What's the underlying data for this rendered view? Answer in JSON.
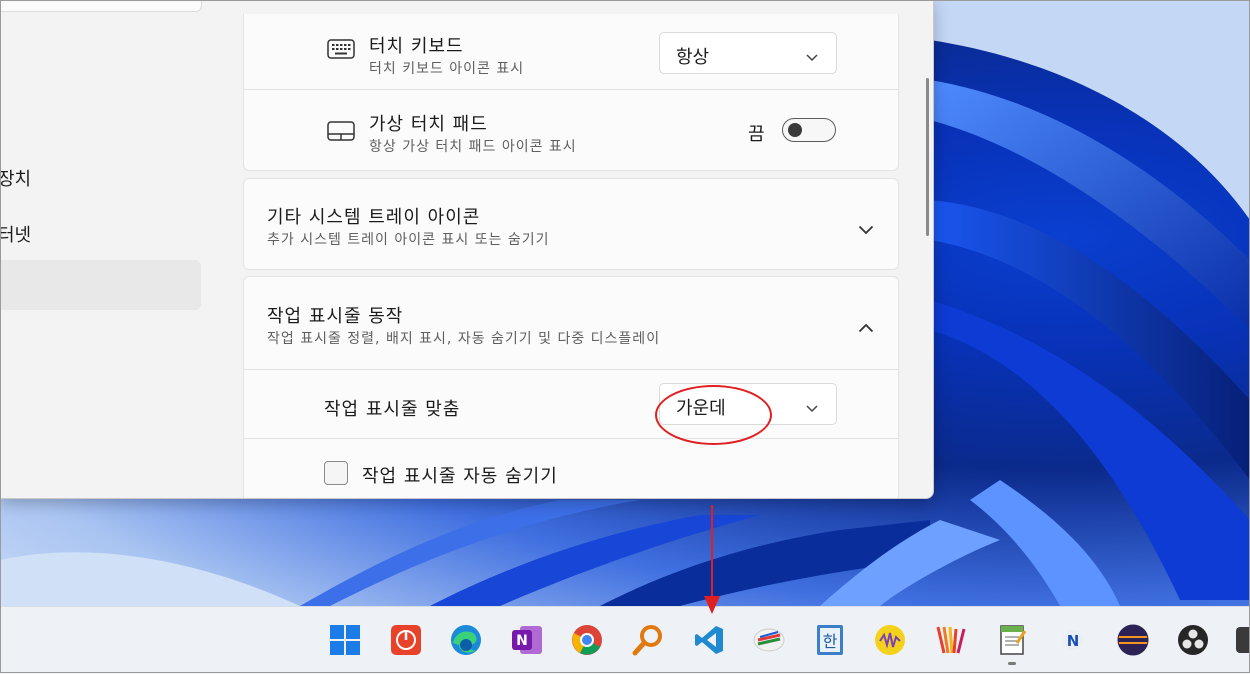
{
  "nav": {
    "item_devices": "장치",
    "item_network": "터넷"
  },
  "rows": {
    "touch_keyboard": {
      "title": "터치 키보드",
      "subtitle": "터치 키보드 아이콘 표시",
      "dropdown_value": "항상",
      "icon": "keyboard-icon"
    },
    "virtual_touchpad": {
      "title": "가상 터치 패드",
      "subtitle": "항상 가상 터치 패드 아이콘 표시",
      "toggle_label": "끔",
      "toggle_state": "off",
      "icon": "touchpad-icon"
    }
  },
  "sections": {
    "other_tray": {
      "title": "기타 시스템 트레이 아이콘",
      "subtitle": "추가 시스템 트레이 아이콘 표시 또는 숨기기",
      "expanded": false
    },
    "taskbar_behavior": {
      "title": "작업 표시줄 동작",
      "subtitle": "작업 표시줄 정렬, 배지 표시, 자동 숨기기 및 다중 디스플레이",
      "expanded": true,
      "alignment_label": "작업 표시줄 맞춤",
      "alignment_value": "가운데",
      "autohide_label": "작업 표시줄 자동 숨기기",
      "autohide_checked": false
    }
  },
  "annotation": {
    "highlight_color": "#e02020"
  },
  "taskbar": {
    "icons": [
      "windows-start-icon",
      "power-app-icon",
      "edge-icon",
      "onenote-icon",
      "chrome-icon",
      "search-magnifier-icon",
      "vscode-icon",
      "cc-app-icon",
      "hangul-icon",
      "audio-app-icon",
      "stripes-app-icon",
      "notepad-app-icon",
      "n-app-icon",
      "eclipse-icon",
      "obs-icon",
      "partial-app-icon"
    ],
    "background": "#eef2f7"
  }
}
